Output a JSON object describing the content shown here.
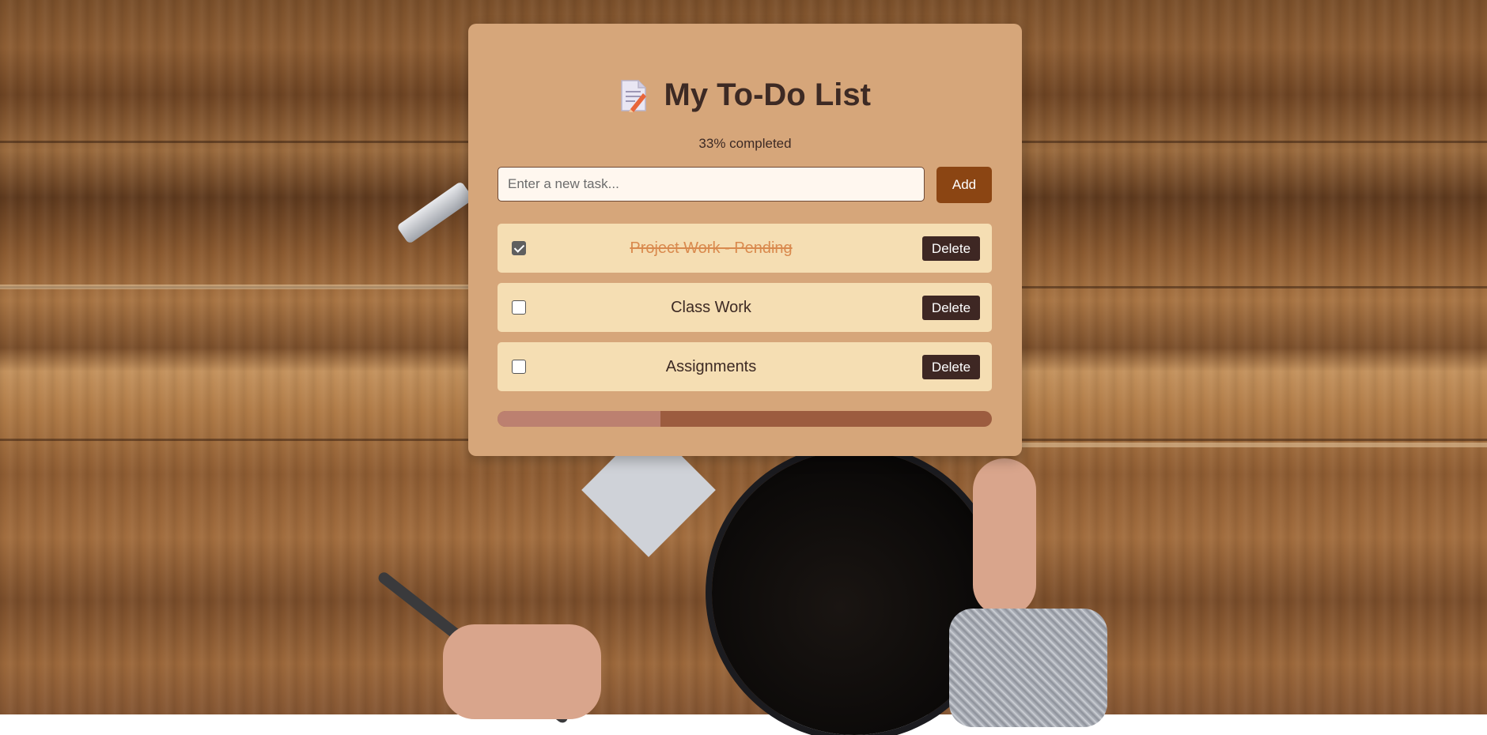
{
  "app": {
    "title": "My To-Do List",
    "title_icon": "memo-icon",
    "progress_text": "33% completed",
    "progress_fraction": 0.33
  },
  "input": {
    "value": "",
    "placeholder": "Enter a new task..."
  },
  "add_button": {
    "label": "Add"
  },
  "tasks": [
    {
      "label": "Project Work - Pending",
      "completed": true,
      "delete_label": "Delete"
    },
    {
      "label": "Class Work",
      "completed": false,
      "delete_label": "Delete"
    },
    {
      "label": "Assignments",
      "completed": false,
      "delete_label": "Delete"
    }
  ],
  "colors": {
    "card": "#d6a67a",
    "task_bg": "#f5deb3",
    "add_button": "#8b4513",
    "delete_button": "#3e2723",
    "done_text": "#d98a4e",
    "progress_track": "#9c5c3f",
    "progress_fill": "#bc8070"
  }
}
